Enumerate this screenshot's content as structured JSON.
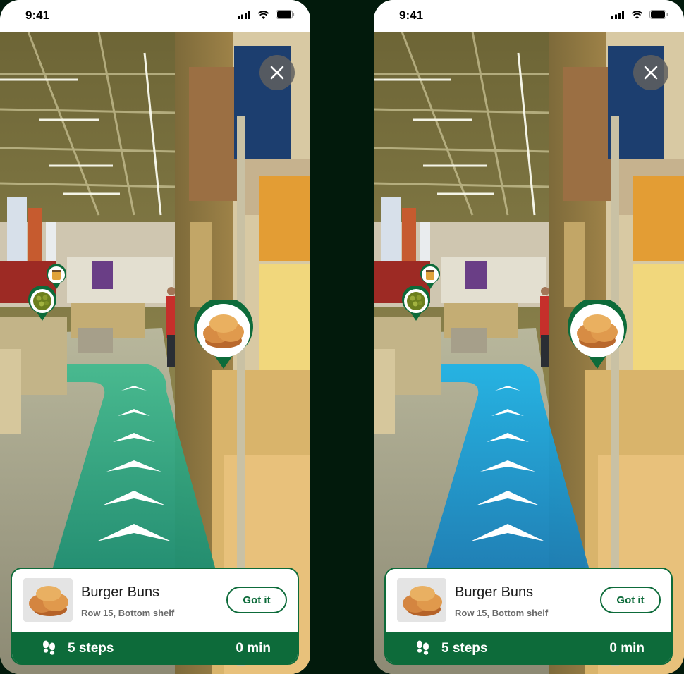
{
  "screens": [
    {
      "variant": "green-path",
      "path_color": "#3dba8e",
      "status": {
        "time": "9:41"
      },
      "item": {
        "name": "Burger Buns",
        "location": "Row 15, Bottom shelf"
      },
      "action_label": "Got it",
      "footer": {
        "steps": "5 steps",
        "duration": "0 min"
      },
      "icons": [
        "close-icon",
        "burger-buns-pin-icon",
        "peas-pin-icon",
        "jar-pin-icon",
        "footsteps-icon"
      ]
    },
    {
      "variant": "blue-path",
      "path_color": "#1fa6d8",
      "status": {
        "time": "9:41"
      },
      "item": {
        "name": "Burger Buns",
        "location": "Row 15, Bottom shelf"
      },
      "action_label": "Got it",
      "footer": {
        "steps": "5 steps",
        "duration": "0 min"
      },
      "icons": [
        "close-icon",
        "burger-buns-pin-icon",
        "peas-pin-icon",
        "jar-pin-icon",
        "footsteps-icon"
      ]
    }
  ],
  "colors": {
    "brand_green": "#0d6b3a",
    "background": "#021a0c"
  }
}
